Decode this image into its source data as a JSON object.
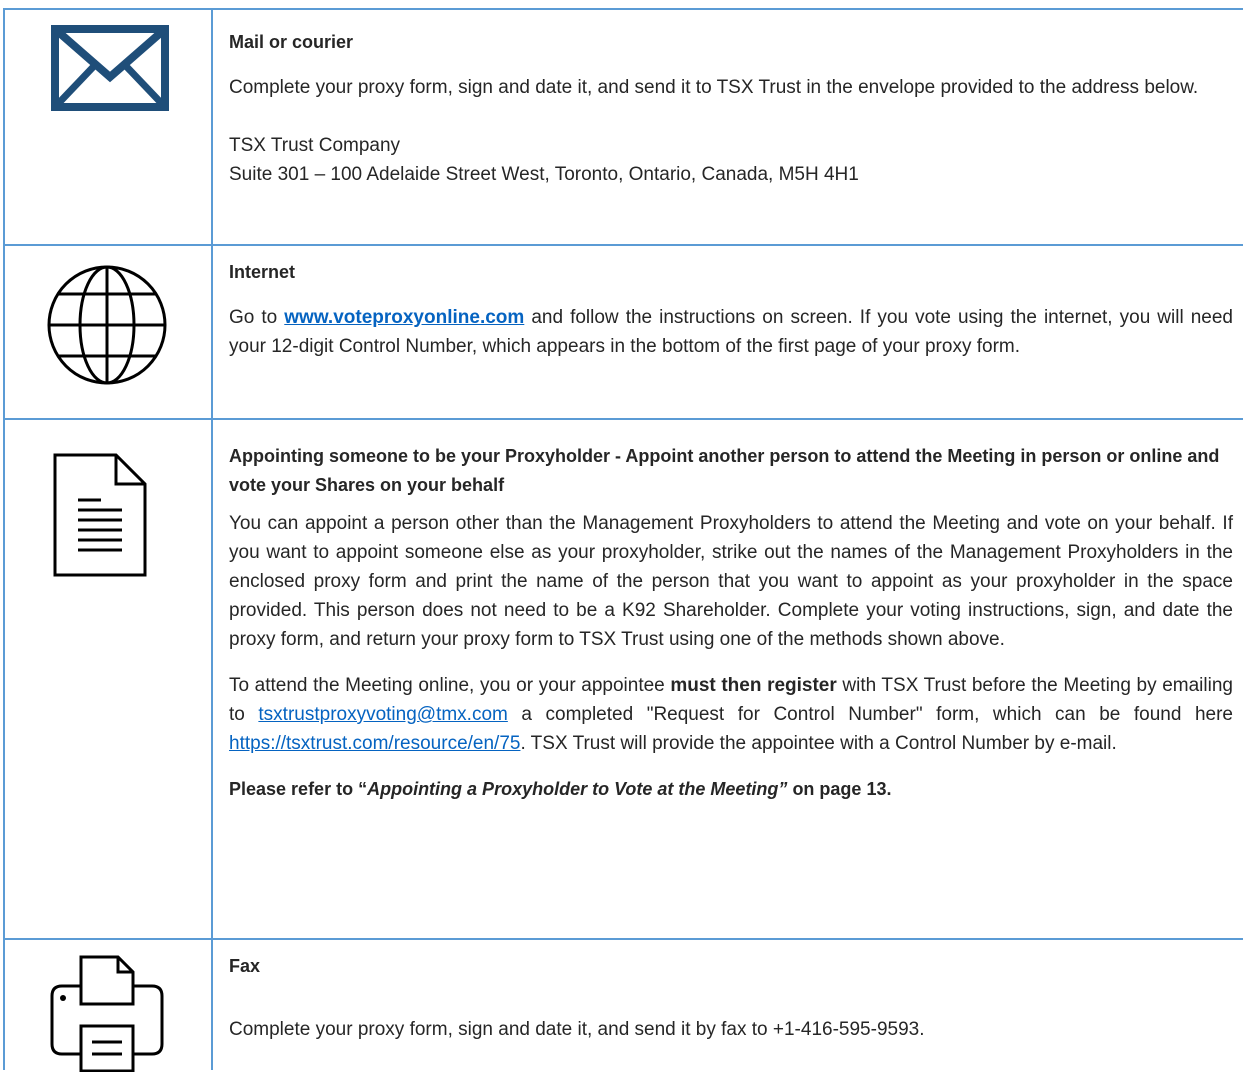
{
  "mail": {
    "heading": "Mail or courier",
    "body": "Complete your proxy form, sign and date it, and send it to TSX Trust in the envelope provided to the address below.",
    "address_line1": "TSX Trust Company",
    "address_line2": "Suite 301 – 100 Adelaide Street West, Toronto, Ontario, Canada, M5H 4H1",
    "icon": "envelope-icon"
  },
  "internet": {
    "heading": "Internet",
    "body_pre": "Go to ",
    "link": "www.voteproxyonline.com",
    "body_post": "  and follow the instructions on screen. If you vote using the internet, you will need your 12-digit Control Number, which appears in the bottom of the first page of your proxy form.",
    "icon": "globe-icon"
  },
  "appoint": {
    "heading": "Appointing someone to be your Proxyholder - Appoint another person to attend the Meeting in person or online and vote your Shares on your behalf",
    "body1": "You can appoint a person other than the Management Proxyholders to attend the Meeting and vote on your behalf. If you want to appoint someone else as your proxyholder, strike out the names of the Management Proxyholders in the enclosed proxy form and print the name of the person that you want to appoint as your proxyholder in the space provided. This person does not need to be a K92 Shareholder. Complete your voting instructions, sign, and date the proxy form, and return your proxy form to TSX Trust using one of the methods shown above.",
    "body2_a": "To attend the Meeting online, you or your appointee ",
    "body2_bold": "must then register",
    "body2_b": " with TSX Trust before the Meeting by emailing to ",
    "email_link": "tsxtrustproxyvoting@tmx.com",
    "body2_c": " a completed \"Request for Control Number\" form, which can be found here ",
    "url_link": "https://tsxtrust.com/resource/en/75",
    "body2_d": ". TSX Trust will provide the appointee with a Control Number by e-mail.",
    "refer_a": "Please refer to “",
    "refer_italic": "Appointing a Proxyholder to Vote at the Meeting”",
    "refer_b": " on page 13.",
    "icon": "document-icon"
  },
  "fax": {
    "heading": "Fax",
    "body": "Complete your proxy form, sign and date it, and send it by fax to +1-416-595-9593.",
    "icon": "fax-icon"
  },
  "colors": {
    "border": "#5b9bd5",
    "icon": "#1f4e79",
    "link": "#0563c1",
    "text": "#262626"
  }
}
